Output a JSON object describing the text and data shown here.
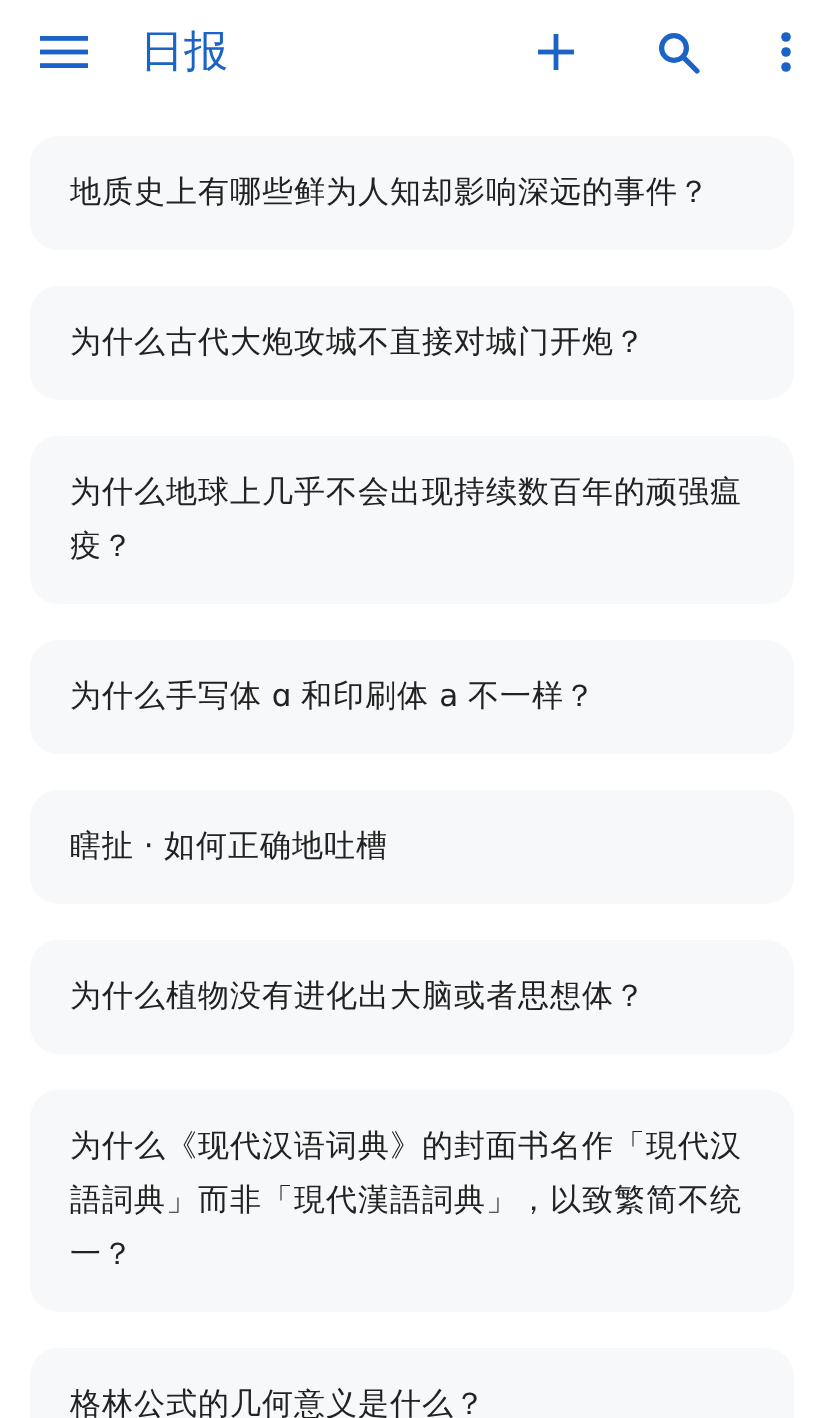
{
  "app_bar": {
    "title": "日报"
  },
  "stories": [
    {
      "title": "地质史上有哪些鲜为人知却影响深远的事件？"
    },
    {
      "title": "为什么古代大炮攻城不直接对城门开炮？"
    },
    {
      "title": "为什么地球上几乎不会出现持续数百年的顽强瘟疫？"
    },
    {
      "title": "为什么手写体 ɑ 和印刷体 a 不一样？"
    },
    {
      "title": "瞎扯 · 如何正确地吐槽"
    },
    {
      "title": "为什么植物没有进化出大脑或者思想体？"
    },
    {
      "title": "为什么《现代汉语词典》的封面书名作「現代汉語詞典」而非「現代漢語詞典」，以致繁简不统一？"
    },
    {
      "title": "格林公式的几何意义是什么？"
    }
  ]
}
